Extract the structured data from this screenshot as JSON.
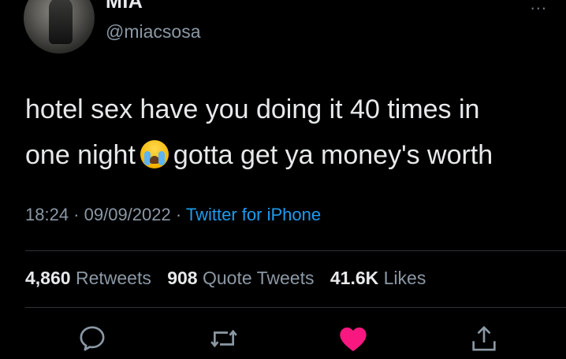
{
  "tweet": {
    "display_name": "MIA",
    "handle": "@miacsosa",
    "more_label": "...",
    "text_line1": "hotel sex have you doing it 40 times in",
    "text_line2_before": "one night",
    "text_line2_after": "gotta get ya money's worth",
    "emoji": "crying-face-emoji"
  },
  "meta": {
    "time": "18:24",
    "sep1": " · ",
    "date": "09/09/2022",
    "sep2": " · ",
    "source": "Twitter for iPhone"
  },
  "stats": {
    "retweets_count": "4,860",
    "retweets_label": "Retweets",
    "quotes_count": "908",
    "quotes_label": "Quote Tweets",
    "likes_count": "41.6K",
    "likes_label": "Likes"
  },
  "actions": {
    "reply_icon": "reply-icon",
    "retweet_icon": "retweet-icon",
    "like_icon": "heart-icon",
    "share_icon": "share-icon",
    "liked": true
  },
  "colors": {
    "background": "#000000",
    "text": "#e7e9ea",
    "secondary": "#8b98a5",
    "link": "#1d9bf0",
    "like": "#f91880"
  }
}
